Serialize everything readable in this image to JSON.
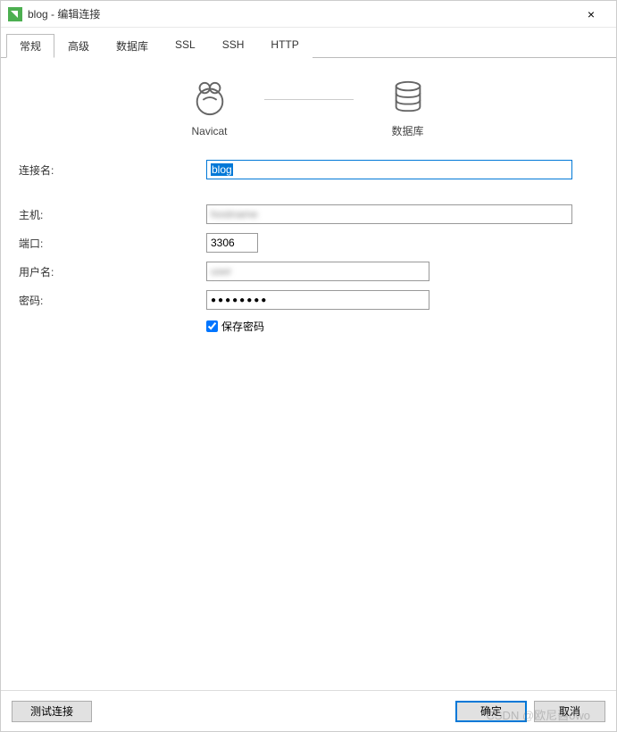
{
  "titlebar": {
    "title": "blog - 编辑连接",
    "close": "×"
  },
  "tabs": [
    {
      "label": "常规",
      "active": true
    },
    {
      "label": "高级",
      "active": false
    },
    {
      "label": "数据库",
      "active": false
    },
    {
      "label": "SSL",
      "active": false
    },
    {
      "label": "SSH",
      "active": false
    },
    {
      "label": "HTTP",
      "active": false
    }
  ],
  "icons": {
    "navicat_label": "Navicat",
    "database_label": "数据库"
  },
  "form": {
    "connection_name_label": "连接名:",
    "connection_name_value": "blog",
    "host_label": "主机:",
    "host_value": "",
    "port_label": "端口:",
    "port_value": "3306",
    "username_label": "用户名:",
    "username_value": "",
    "password_label": "密码:",
    "password_value": "●●●●●●●●",
    "save_password_label": "保存密码",
    "save_password_checked": true
  },
  "footer": {
    "test_connection": "测试连接",
    "ok": "确定",
    "cancel": "取消"
  },
  "watermark": "CSDN @欧尼酱owo"
}
